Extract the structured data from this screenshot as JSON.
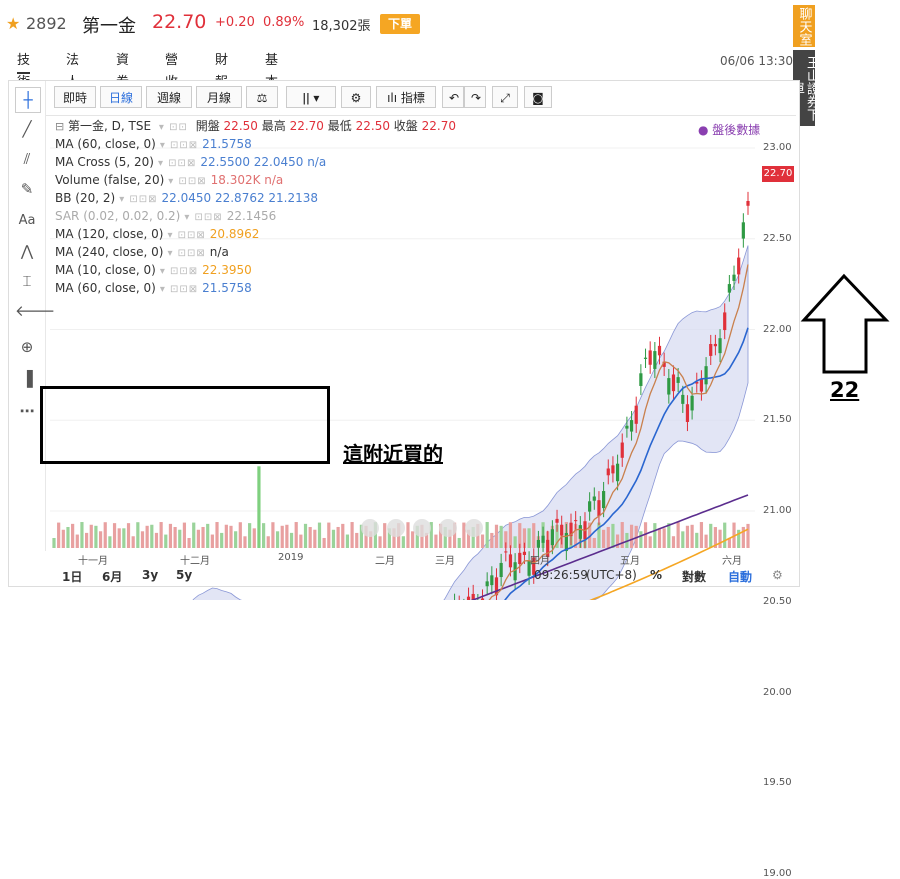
{
  "header": {
    "code": "2892",
    "name": "第一金",
    "price": "22.70",
    "change": "+0.20",
    "change_pct": "0.89%",
    "volume": "18,302張",
    "order_button": "下單"
  },
  "tabs": [
    "技術",
    "法人",
    "營收",
    "營收",
    "財報",
    "基本"
  ],
  "datetime": "06/06 13:30",
  "side_panels": {
    "chat": "聊天室",
    "bank": "玉山證券下單"
  },
  "toolbar": {
    "buttons": [
      "即時",
      "日線",
      "週線",
      "月線"
    ],
    "indicator_label": "指標"
  },
  "indicators": {
    "main": "第一金, D, TSE",
    "open_label": "開盤",
    "open": "22.50",
    "high_label": "最高",
    "high": "22.70",
    "low_label": "最低",
    "low": "22.50",
    "close_label": "收盤",
    "close": "22.70",
    "rows": [
      {
        "name": "MA (60, close, 0)",
        "value": "21.5758",
        "color": "#4a7fd0"
      },
      {
        "name": "MA Cross (5, 20)",
        "value": "22.5500  22.0450  n/a",
        "color": "#4a7fd0"
      },
      {
        "name": "Volume (false, 20)",
        "value": "18.302K  n/a",
        "color": "#e07070"
      },
      {
        "name": "BB (20, 2)",
        "value": "22.0450  22.8762  21.2138",
        "color": "#4a7fd0"
      },
      {
        "name": "SAR (0.02, 0.02, 0.2)",
        "value": "22.1456",
        "color": "#aaaaaa"
      },
      {
        "name": "MA (120, close, 0)",
        "value": "20.8962",
        "color": "#f0a020"
      },
      {
        "name": "MA (240, close, 0)",
        "value": "n/a",
        "color": "#333333"
      },
      {
        "name": "MA (10, close, 0)",
        "value": "22.3950",
        "color": "#f0a020"
      },
      {
        "name": "MA (60, close, 0)",
        "value": "21.5758",
        "color": "#4a7fd0"
      }
    ],
    "after_hours": "● 盤後數據"
  },
  "price_axis": [
    "23.00",
    "22.50",
    "22.00",
    "21.50",
    "21.00",
    "20.50",
    "20.00",
    "19.50",
    "19.00"
  ],
  "current_price_tag": "22.70",
  "time_axis": [
    "十一月",
    "十二月",
    "2019",
    "二月",
    "三月",
    "四月",
    "五月",
    "六月"
  ],
  "bottom_bar": {
    "ranges": [
      "1日",
      "6月",
      "3y",
      "5y"
    ],
    "clock": "09:26:59",
    "tz": "(UTC+8)",
    "pct": "%",
    "log": "對數",
    "auto": "自動"
  },
  "annotation": {
    "text": "這附近買的",
    "number": "22"
  },
  "colors": {
    "up": "#e0303a",
    "down": "#2f9a44",
    "ma_blue": "#2a66d0",
    "ma_orange": "#f5a623",
    "ma_purple": "#5b2d8e",
    "band_fill": "#d8dcf2"
  }
}
